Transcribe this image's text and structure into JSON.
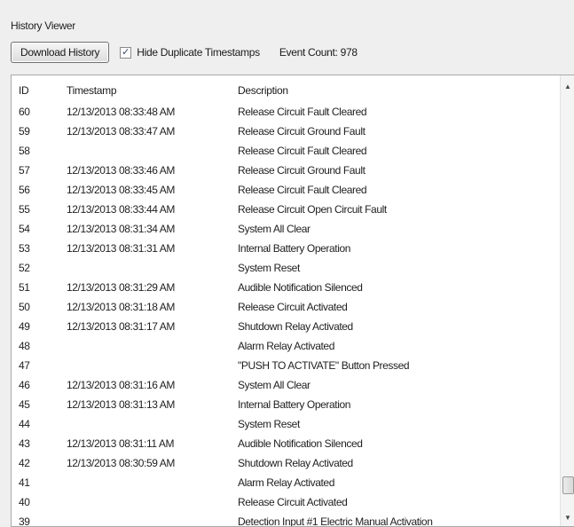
{
  "window": {
    "title": "History Viewer"
  },
  "toolbar": {
    "download_label": "Download History",
    "hide_dup_label": "Hide Duplicate Timestamps",
    "hide_dup_checked": true,
    "event_count_label": "Event Count: 978"
  },
  "table": {
    "columns": {
      "id": "ID",
      "timestamp": "Timestamp",
      "description": "Description"
    },
    "rows": [
      {
        "id": "60",
        "timestamp": "12/13/2013 08:33:48 AM",
        "description": "Release Circuit Fault Cleared"
      },
      {
        "id": "59",
        "timestamp": "12/13/2013 08:33:47 AM",
        "description": "Release Circuit Ground Fault"
      },
      {
        "id": "58",
        "timestamp": "",
        "description": "Release Circuit Fault Cleared"
      },
      {
        "id": "57",
        "timestamp": "12/13/2013 08:33:46 AM",
        "description": "Release Circuit Ground Fault"
      },
      {
        "id": "56",
        "timestamp": "12/13/2013 08:33:45 AM",
        "description": "Release Circuit Fault Cleared"
      },
      {
        "id": "55",
        "timestamp": "12/13/2013 08:33:44 AM",
        "description": "Release Circuit Open Circuit Fault"
      },
      {
        "id": "54",
        "timestamp": "12/13/2013 08:31:34 AM",
        "description": "System All Clear"
      },
      {
        "id": "53",
        "timestamp": "12/13/2013 08:31:31 AM",
        "description": "Internal Battery Operation"
      },
      {
        "id": "52",
        "timestamp": "",
        "description": "System Reset"
      },
      {
        "id": "51",
        "timestamp": "12/13/2013 08:31:29 AM",
        "description": "Audible Notification Silenced"
      },
      {
        "id": "50",
        "timestamp": "12/13/2013 08:31:18 AM",
        "description": "Release Circuit Activated"
      },
      {
        "id": "49",
        "timestamp": "12/13/2013 08:31:17 AM",
        "description": "Shutdown Relay Activated"
      },
      {
        "id": "48",
        "timestamp": "",
        "description": "Alarm Relay Activated"
      },
      {
        "id": "47",
        "timestamp": "",
        "description": "\"PUSH TO ACTIVATE\" Button Pressed"
      },
      {
        "id": "46",
        "timestamp": "12/13/2013 08:31:16 AM",
        "description": "System All Clear"
      },
      {
        "id": "45",
        "timestamp": "12/13/2013 08:31:13 AM",
        "description": "Internal Battery Operation"
      },
      {
        "id": "44",
        "timestamp": "",
        "description": "System Reset"
      },
      {
        "id": "43",
        "timestamp": "12/13/2013 08:31:11 AM",
        "description": "Audible Notification Silenced"
      },
      {
        "id": "42",
        "timestamp": "12/13/2013 08:30:59 AM",
        "description": "Shutdown Relay Activated"
      },
      {
        "id": "41",
        "timestamp": "",
        "description": "Alarm Relay Activated"
      },
      {
        "id": "40",
        "timestamp": "",
        "description": "Release Circuit Activated"
      },
      {
        "id": "39",
        "timestamp": "",
        "description": "Detection Input #1 Electric Manual Activation"
      }
    ]
  },
  "icons": {
    "checkbox_check": "check-icon",
    "scroll_up": "arrow-up-icon",
    "scroll_down": "arrow-down-icon"
  }
}
